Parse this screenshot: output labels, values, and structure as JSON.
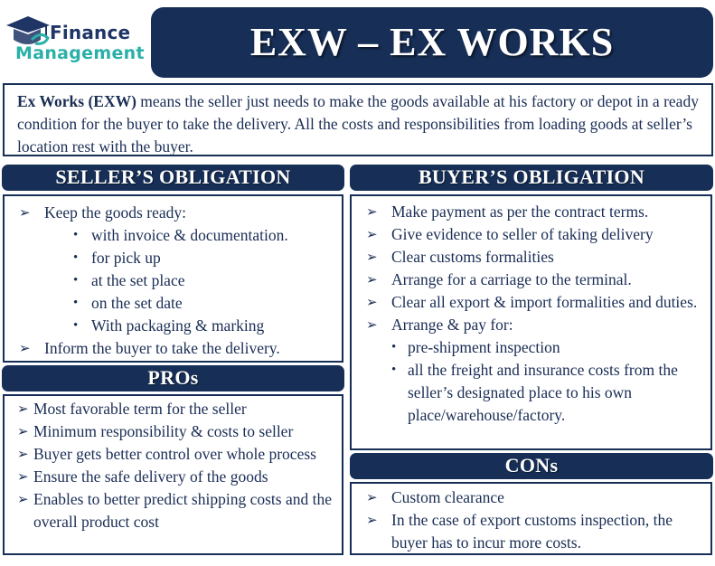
{
  "logo": {
    "line1": "Finance",
    "line2": "Management",
    "icon": "graduation-cap-e-icon",
    "colors": {
      "navy": "#1e3566",
      "teal": "#2ab0a8"
    }
  },
  "title": "EXW – EX WORKS",
  "definition": {
    "term": "Ex Works (EXW)",
    "text": " means the seller just needs to make the goods available at his factory or depot in a ready condition for the buyer to take the delivery. All the costs and responsibilities from loading goods at seller’s location rest with the buyer."
  },
  "theme": {
    "header_bg": "#172f57",
    "border": "#172f57",
    "text": "#1a2d55"
  },
  "seller": {
    "heading": "SELLER’S OBLIGATION",
    "items": [
      {
        "text": "Keep the goods ready:",
        "sub": [
          "with invoice & documentation.",
          "for pick up",
          "at the set place",
          "on the set date",
          "With packaging & marking"
        ]
      },
      {
        "text": "Inform the buyer to take the delivery.",
        "sub": []
      }
    ]
  },
  "buyer": {
    "heading": "BUYER’S OBLIGATION",
    "items": [
      {
        "text": "Make payment as per the contract terms.",
        "sub": []
      },
      {
        "text": "Give evidence to seller of taking delivery",
        "sub": []
      },
      {
        "text": "Clear customs formalities",
        "sub": []
      },
      {
        "text": "Arrange for a carriage to the terminal.",
        "sub": []
      },
      {
        "text": "Clear all export & import formalities and duties.",
        "sub": []
      },
      {
        "text": "Arrange & pay for:",
        "sub": [
          "pre-shipment inspection",
          "all the freight and insurance costs from the seller’s designated place to his own place/warehouse/factory."
        ]
      }
    ]
  },
  "pros": {
    "heading": "PROs",
    "items": [
      "Most favorable term for the seller",
      "Minimum responsibility & costs to seller",
      "Buyer gets  better control over whole process",
      "Ensure the safe delivery of the goods",
      "Enables to better predict shipping costs and the overall product cost"
    ]
  },
  "cons": {
    "heading": "CONs",
    "items": [
      "Custom clearance",
      "In the case of export customs inspection, the buyer has to incur more costs."
    ]
  }
}
